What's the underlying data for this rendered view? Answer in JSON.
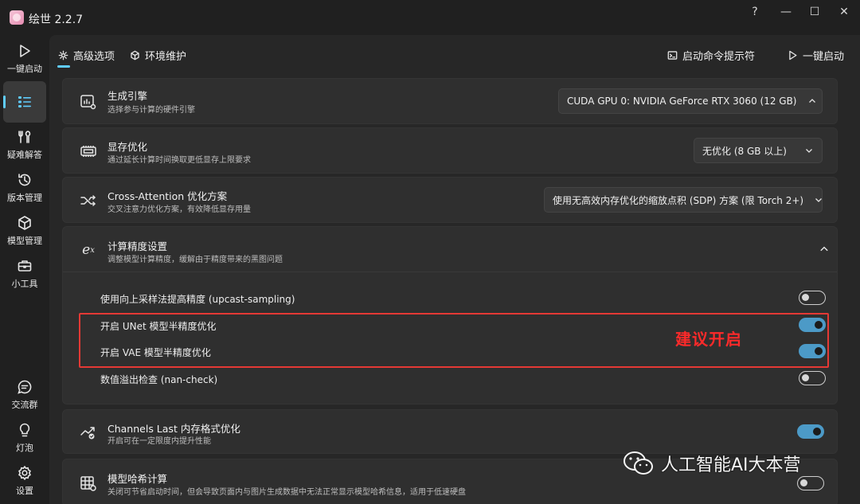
{
  "window": {
    "title": "绘世 2.2.7",
    "help_label": "?",
    "minimize_label": "—",
    "maximize_label": "☐",
    "close_label": "✕"
  },
  "sidebar": {
    "items": [
      {
        "label": "一键启动",
        "icon": "play-icon"
      },
      {
        "label": "",
        "icon": "list-icon"
      },
      {
        "label": "疑难解答",
        "icon": "wrench-icon"
      },
      {
        "label": "版本管理",
        "icon": "history-icon"
      },
      {
        "label": "模型管理",
        "icon": "cube-icon"
      },
      {
        "label": "小工具",
        "icon": "toolbox-icon"
      },
      {
        "label": "交流群",
        "icon": "chat-icon"
      },
      {
        "label": "灯泡",
        "icon": "bulb-icon"
      },
      {
        "label": "设置",
        "icon": "gear-icon"
      }
    ]
  },
  "tabs": {
    "advanced": "高级选项",
    "env": "环境维护",
    "cmd": "启动命令提示符",
    "launch": "一键启动"
  },
  "cards": {
    "engine": {
      "title": "生成引擎",
      "subtitle": "选择参与计算的硬件引擎",
      "value": "CUDA GPU 0: NVIDIA GeForce RTX 3060 (12 GB)"
    },
    "vram": {
      "title": "显存优化",
      "subtitle": "通过延长计算时间换取更低显存上限要求",
      "value": "无优化 (8 GB 以上)"
    },
    "attention": {
      "title": "Cross-Attention 优化方案",
      "subtitle": "交叉注意力优化方案，有效降低显存用量",
      "value": "使用无高效内存优化的缩放点积 (SDP) 方案 (限 Torch 2+)"
    },
    "precision": {
      "title": "计算精度设置",
      "subtitle": "调整模型计算精度，缓解由于精度带来的黑图问题",
      "options": [
        {
          "label": "使用向上采样法提高精度 (upcast-sampling)",
          "on": false
        },
        {
          "label": "开启 UNet 模型半精度优化",
          "on": true
        },
        {
          "label": "开启 VAE 模型半精度优化",
          "on": true
        },
        {
          "label": "数值溢出检查 (nan-check)",
          "on": false
        }
      ]
    },
    "channels": {
      "title": "Channels Last 内存格式优化",
      "subtitle": "开启可在一定限度内提升性能",
      "on": true
    },
    "hash": {
      "title": "模型哈希计算",
      "subtitle": "关闭可节省启动时间，但会导致页面内与图片生成数据中无法正常显示模型哈希信息，适用于低速硬盘",
      "on": false
    }
  },
  "annotation": "建议开启",
  "watermark": "人工智能AI大本营",
  "colors": {
    "accent": "#60cdff",
    "toggle_on": "#4c9ac7",
    "highlight": "#e53935"
  }
}
